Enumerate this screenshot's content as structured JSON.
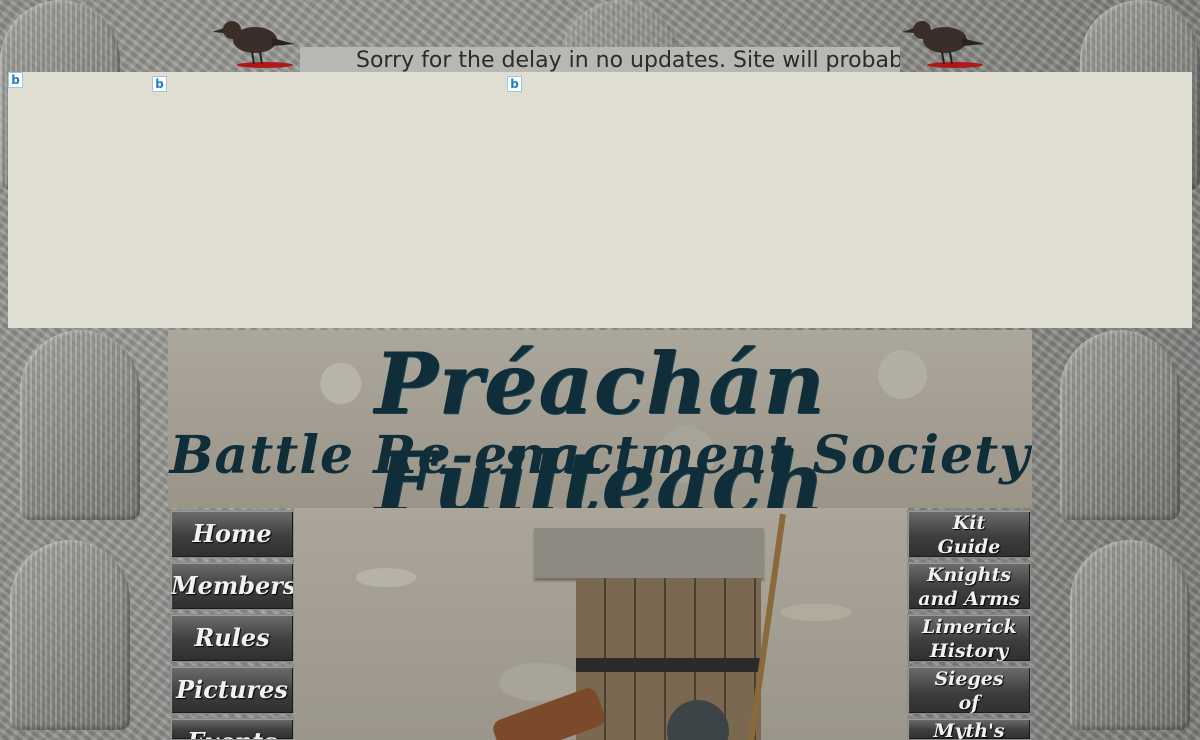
{
  "marquee": {
    "text": "Sorry for the delay in no updates. Site will probably"
  },
  "banner": {
    "title": "Préachán Fuilteach",
    "subtitle": "Battle Re-enactment Society"
  },
  "ad": {
    "icon_label": "b"
  },
  "nav_left": [
    {
      "label": "Home"
    },
    {
      "label": "Members"
    },
    {
      "label": "Rules"
    },
    {
      "label": "Pictures"
    },
    {
      "label": "Events"
    }
  ],
  "nav_right": [
    {
      "label": "Kit Guide"
    },
    {
      "label": "Knights and Arms"
    },
    {
      "label": "Limerick History"
    },
    {
      "label": "Sieges of Limerick"
    },
    {
      "label": "Myth's and"
    }
  ]
}
